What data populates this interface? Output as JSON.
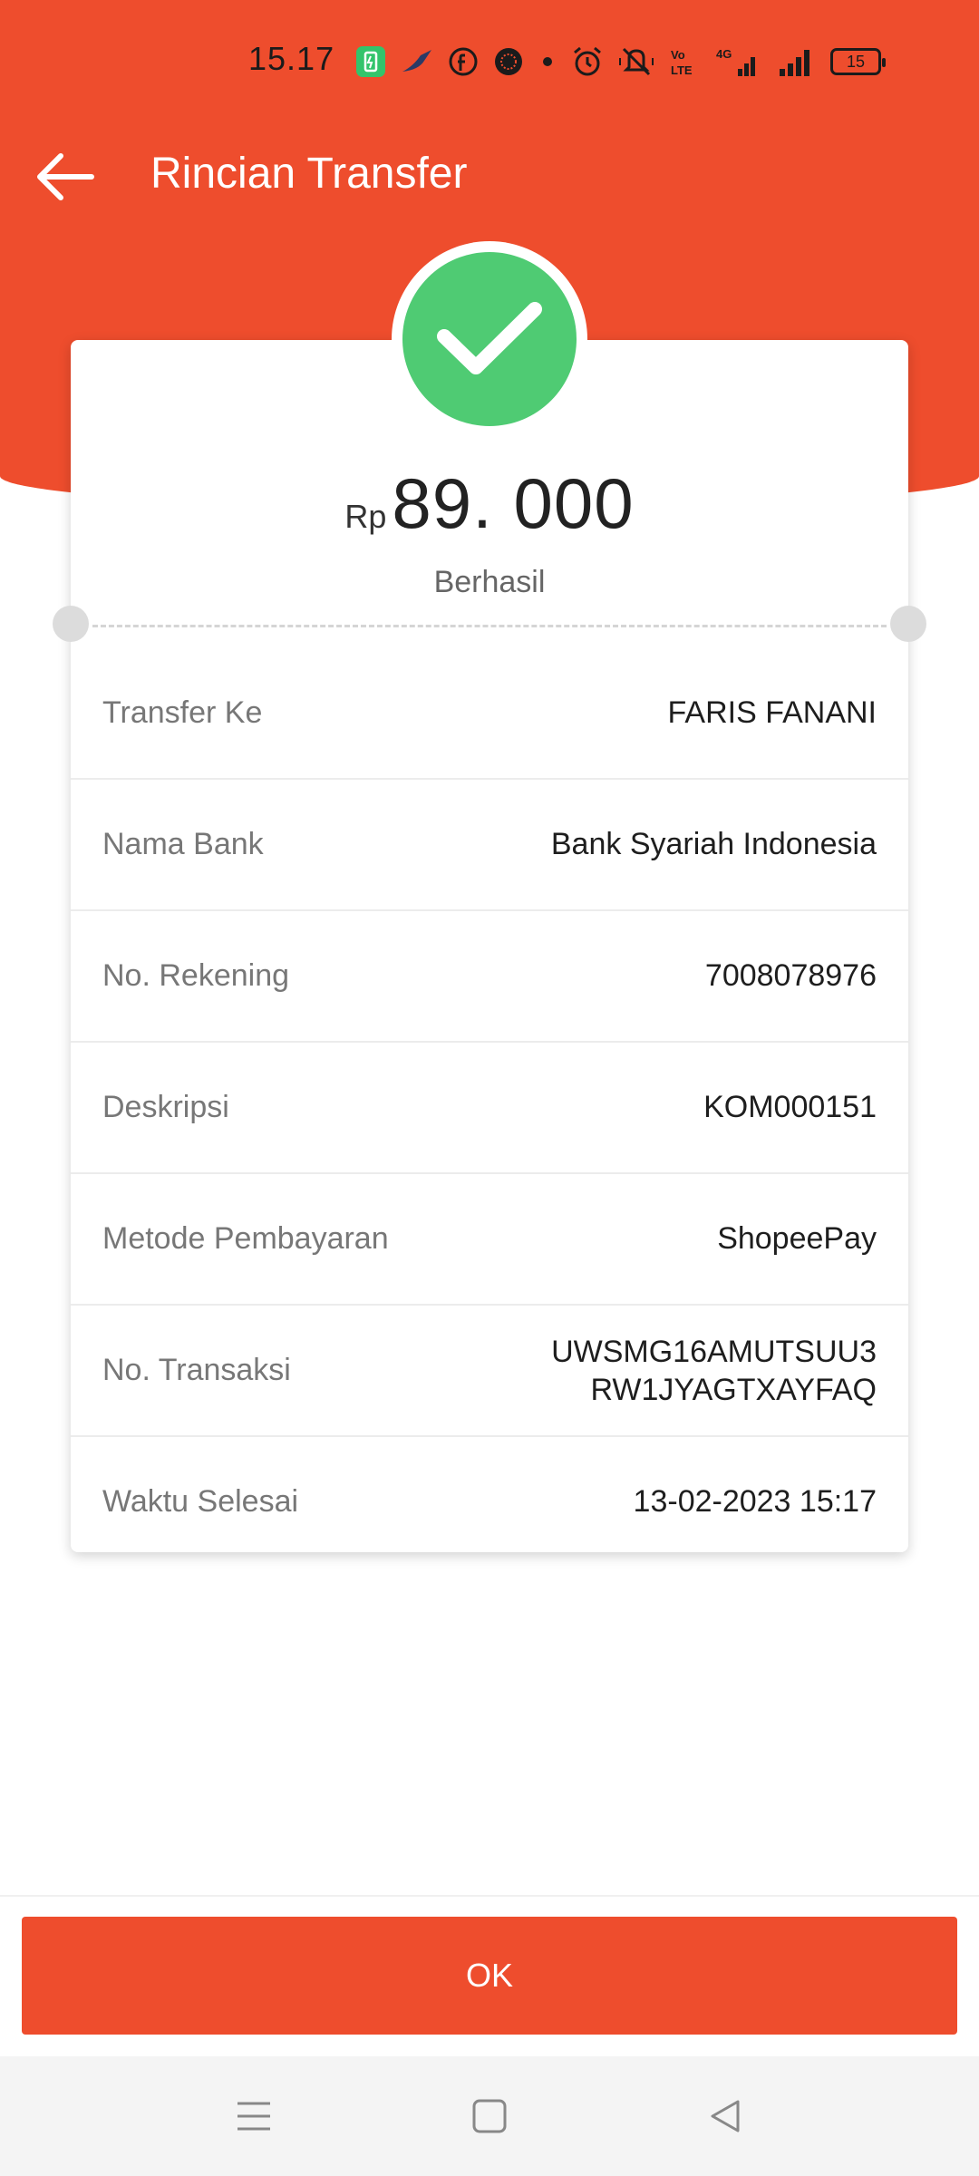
{
  "status_bar": {
    "time": "15.17",
    "battery_level": "15",
    "icons": [
      "battery-saver-icon",
      "bird-app-icon",
      "facebook-icon",
      "app-dot-icon",
      "dot-icon",
      "alarm-icon",
      "mute-icon",
      "volte-icon",
      "signal-4g-icon",
      "signal-icon",
      "battery-icon"
    ]
  },
  "header": {
    "title": "Rincian Transfer"
  },
  "summary": {
    "currency": "Rp",
    "amount": "89. 000",
    "status": "Berhasil"
  },
  "details": {
    "rows": [
      {
        "label": "Transfer Ke",
        "value": "FARIS FANANI"
      },
      {
        "label": "Nama Bank",
        "value": "Bank Syariah Indonesia"
      },
      {
        "label": "No.  Rekening",
        "value": "7008078976"
      },
      {
        "label": "Deskripsi",
        "value": "KOM000151"
      },
      {
        "label": "Metode Pembayaran",
        "value": "ShopeePay"
      },
      {
        "label": "No.  Transaksi",
        "value_line1": "UWSMG16AMUTSUU3",
        "value_line2": "RW1JYAGTXAYFAQ"
      },
      {
        "label": "Waktu Selesai",
        "value": "13-02-2023 15:17"
      }
    ]
  },
  "footer": {
    "ok_label": "OK"
  },
  "colors": {
    "brand": "#ee4d2d",
    "success": "#4fcb73"
  }
}
